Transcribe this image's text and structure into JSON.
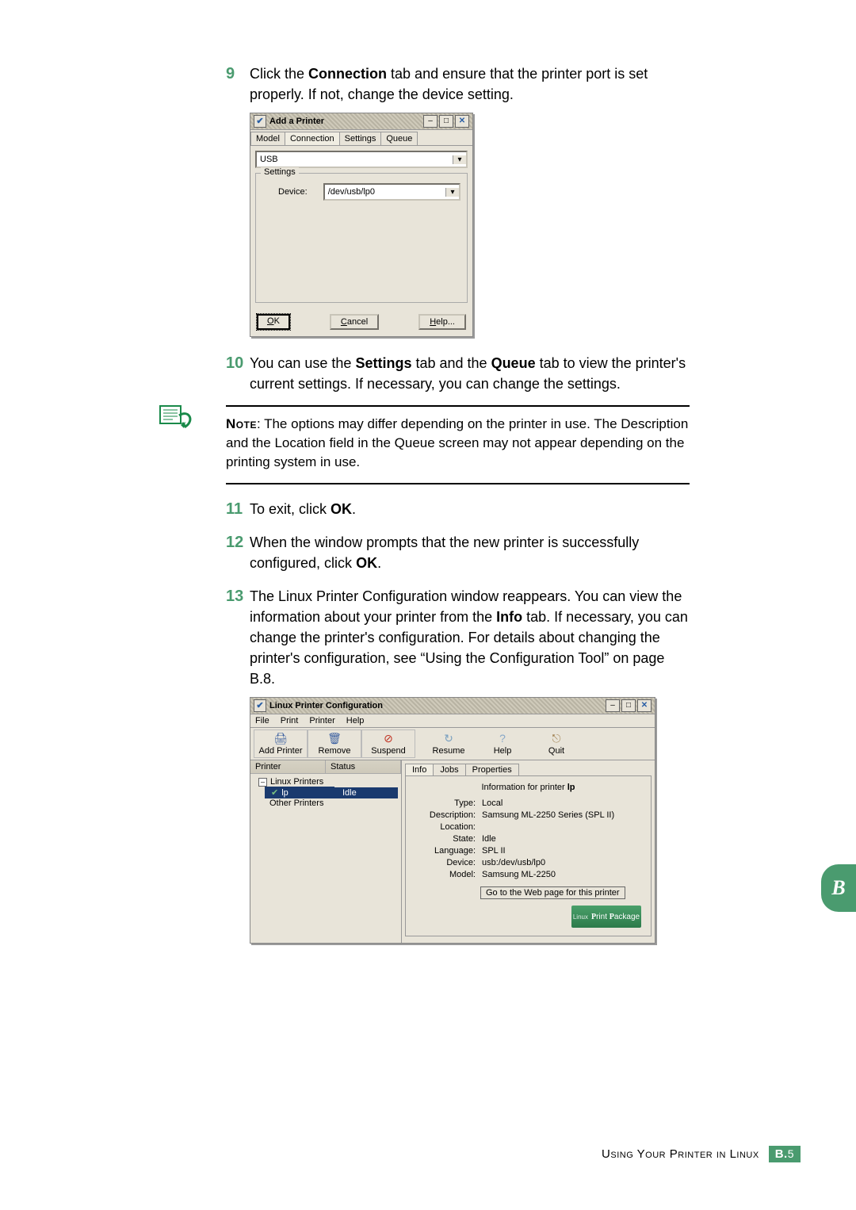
{
  "steps": {
    "s9": {
      "num": "9",
      "text_pre": "Click the ",
      "bold1": "Connection",
      "text_post": " tab and ensure that the printer port is set properly. If not, change the device setting."
    },
    "s10": {
      "num": "10",
      "pre": "You can use the ",
      "b1": "Settings",
      "mid": " tab and the ",
      "b2": "Queue",
      "post": " tab to view the printer's current settings. If necessary, you can change the settings."
    },
    "s11": {
      "num": "11",
      "pre": "To exit, click ",
      "b1": "OK",
      "post": "."
    },
    "s12": {
      "num": "12",
      "pre": "When the window prompts that the new printer is successfully configured, click ",
      "b1": "OK",
      "post": "."
    },
    "s13": {
      "num": "13",
      "pre": "The Linux Printer Configuration window reappears. You can view the information about your printer from the ",
      "b1": "Info",
      "post": " tab. If necessary, you can change the printer's configuration. For details about changing the printer's configuration, see “Using the Configuration Tool” on page B.8."
    }
  },
  "note": {
    "label": "Note",
    "text": ": The options may differ depending on the printer in use. The Description and the Location field in the Queue screen may not appear depending on the printing system in use."
  },
  "add_printer": {
    "title": "Add a Printer",
    "tabs": {
      "model": "Model",
      "connection": "Connection",
      "settings": "Settings",
      "queue": "Queue"
    },
    "conn_type": "USB",
    "settings_legend": "Settings",
    "device_label": "Device:",
    "device_value": "/dev/usb/lp0",
    "ok": "OK",
    "cancel": "Cancel",
    "help": "Help..."
  },
  "lpc": {
    "title": "Linux Printer Configuration",
    "menu": {
      "file": "File",
      "print": "Print",
      "printer": "Printer",
      "help": "Help"
    },
    "tools": {
      "add": "Add Printer",
      "remove": "Remove",
      "suspend": "Suspend",
      "resume": "Resume",
      "help": "Help",
      "quit": "Quit"
    },
    "tree": {
      "col_printer": "Printer",
      "col_status": "Status",
      "root": "Linux Printers",
      "item_name": "lp",
      "item_status": "Idle",
      "other": "Other Printers"
    },
    "info_tabs": {
      "info": "Info",
      "jobs": "Jobs",
      "props": "Properties"
    },
    "info": {
      "header_pre": "Information for printer ",
      "header_name": "lp",
      "type_k": "Type:",
      "type_v": "Local",
      "desc_k": "Description:",
      "desc_v": "Samsung ML-2250 Series (SPL II)",
      "loc_k": "Location:",
      "loc_v": "",
      "state_k": "State:",
      "state_v": "Idle",
      "lang_k": "Language:",
      "lang_v": "SPL II",
      "dev_k": "Device:",
      "dev_v": "usb:/dev/usb/lp0",
      "model_k": "Model:",
      "model_v": "Samsung ML-2250",
      "goweb": "Go to the Web page for this printer",
      "logo_small": "Linux",
      "logo_big": "Print Package"
    }
  },
  "footer": {
    "text": "Using Your Printer in Linux",
    "page_major": "B.",
    "page_minor": "5"
  },
  "side_tab": "B"
}
